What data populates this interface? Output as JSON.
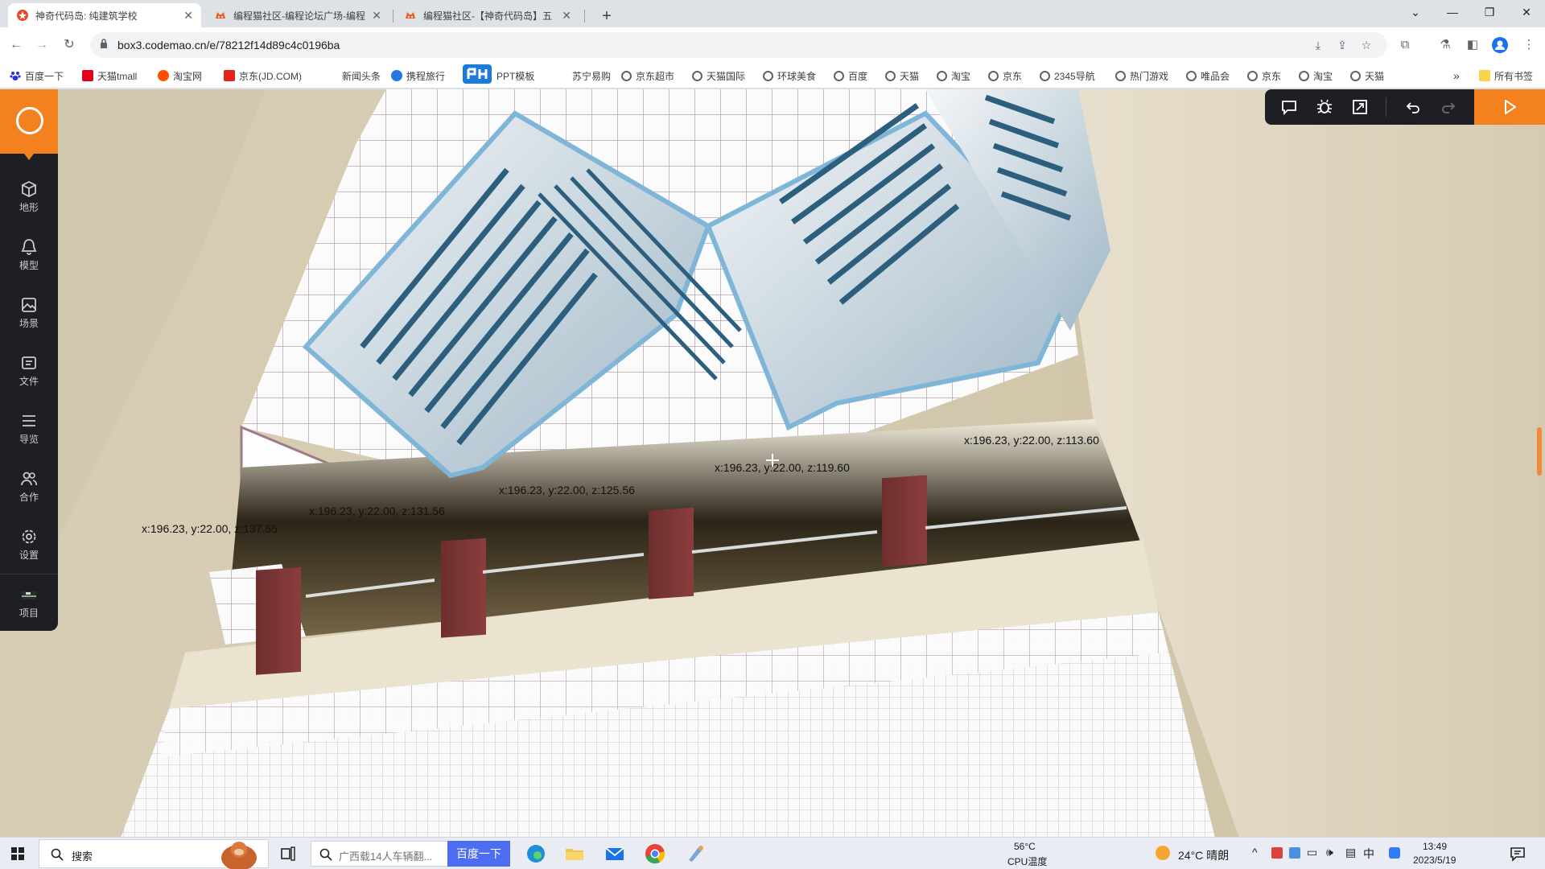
{
  "browser": {
    "tabs": [
      {
        "title": "神奇代码岛: 纯建筑学校",
        "icon": "codemao-star-icon",
        "active": true
      },
      {
        "title": "编程猫社区-编程论坛广场-编程",
        "icon": "codemao-cat-icon",
        "active": false
      },
      {
        "title": "编程猫社区-【神奇代码岛】五",
        "icon": "codemao-cat-icon",
        "active": false
      }
    ],
    "url": "box3.codemao.cn/e/78212f14d89c4c0196ba"
  },
  "bookmarks": [
    {
      "label": "百度一下",
      "icon": "baidu-icon",
      "color": "#2932e1"
    },
    {
      "label": "天猫tmall",
      "icon": "tmall-icon",
      "color": "#e3001b"
    },
    {
      "label": "淘宝网",
      "icon": "taobao-icon",
      "color": "#ff5000"
    },
    {
      "label": "京东(JD.COM)",
      "icon": "jd-icon",
      "color": "#e1251b"
    },
    {
      "label": "新闻头条",
      "icon": "news-icon",
      "color": ""
    },
    {
      "label": "携程旅行",
      "icon": "ctrip-icon",
      "color": "#2577e3"
    },
    {
      "label": "PPT模板",
      "icon": "ppt-icon",
      "color": "#1c7ad9"
    },
    {
      "label": "苏宁易购",
      "icon": "suning-icon",
      "color": ""
    },
    {
      "label": "京东超市",
      "icon": "globe-icon",
      "color": ""
    },
    {
      "label": "天猫国际",
      "icon": "globe-icon",
      "color": ""
    },
    {
      "label": "环球美食",
      "icon": "globe-icon",
      "color": ""
    },
    {
      "label": "百度",
      "icon": "globe-icon",
      "color": ""
    },
    {
      "label": "天猫",
      "icon": "globe-icon",
      "color": ""
    },
    {
      "label": "淘宝",
      "icon": "globe-icon",
      "color": ""
    },
    {
      "label": "京东",
      "icon": "globe-icon",
      "color": ""
    },
    {
      "label": "2345导航",
      "icon": "globe-icon",
      "color": ""
    },
    {
      "label": "热门游戏",
      "icon": "globe-icon",
      "color": ""
    },
    {
      "label": "唯品会",
      "icon": "globe-icon",
      "color": ""
    },
    {
      "label": "京东",
      "icon": "globe-icon",
      "color": ""
    },
    {
      "label": "淘宝",
      "icon": "globe-icon",
      "color": ""
    },
    {
      "label": "天猫",
      "icon": "globe-icon",
      "color": ""
    }
  ],
  "bookmarks_overflow": "»",
  "all_bookmarks": "所有书签",
  "sidebar": {
    "items": [
      {
        "label": "地形",
        "icon": "cube-icon"
      },
      {
        "label": "模型",
        "icon": "bell-model-icon"
      },
      {
        "label": "场景",
        "icon": "image-icon"
      },
      {
        "label": "文件",
        "icon": "folder-icon"
      },
      {
        "label": "导览",
        "icon": "list-icon"
      },
      {
        "label": "合作",
        "icon": "people-icon"
      },
      {
        "label": "设置",
        "icon": "gear-icon"
      },
      {
        "label": "项目",
        "icon": "project-thumbnail-icon"
      }
    ]
  },
  "editor_toolbar": {
    "buttons": [
      "chat-icon",
      "bug-icon",
      "resize-icon",
      "undo-icon",
      "redo-icon",
      "play-icon"
    ],
    "accent": "#f4811f"
  },
  "coord_labels": [
    "x:196.23, y:22.00, z:137.55",
    "x:196.23, y:22.00, z:131.56",
    "x:196.23, y:22.00, z:125.56",
    "x:196.23, y:22.00, z:119.60",
    "x:196.23, y:22.00, z:113.60"
  ],
  "taskbar": {
    "search_label": "搜索",
    "search_query": "广西载14人车辆翻...",
    "search_button": "百度一下",
    "cpu_temp": "56°C",
    "cpu_label": "CPU温度",
    "weather": "24°C 晴朗",
    "time": "13:49",
    "date": "2023/5/19"
  }
}
